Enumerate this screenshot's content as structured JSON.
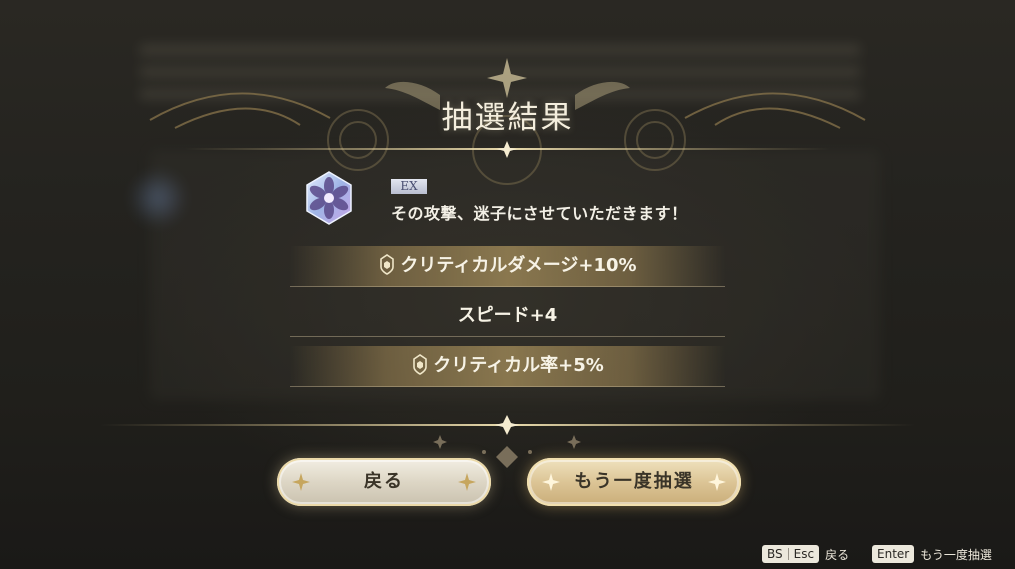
{
  "dialog": {
    "title": "抽選結果",
    "skill": {
      "icon": "flower-crystal-icon",
      "tag": "EX",
      "description": "その攻撃、迷子にさせていただきます！"
    },
    "stats": [
      {
        "label": "クリティカルダメージ+10%",
        "highlight": true,
        "crest": true
      },
      {
        "label": "スピード+4",
        "highlight": false,
        "crest": false
      },
      {
        "label": "クリティカル率+5%",
        "highlight": true,
        "crest": true
      }
    ]
  },
  "buttons": {
    "back_label": "戻る",
    "retry_label": "もう一度抽選"
  },
  "hints": {
    "back_key_1": "BS",
    "back_key_2": "Esc",
    "back_action": "戻る",
    "retry_key": "Enter",
    "retry_action": "もう一度抽選"
  },
  "colors": {
    "gold": "#c9ad78",
    "title_text": "#f4eedd",
    "ex_tag_text": "#4a4f72"
  }
}
